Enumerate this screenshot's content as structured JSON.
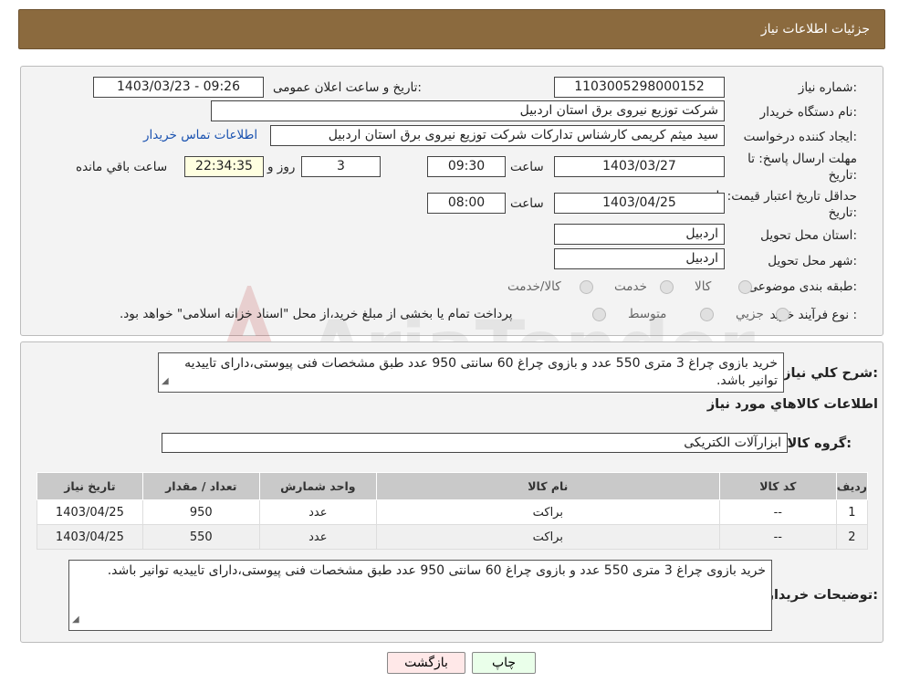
{
  "header": {
    "title": "جزئیات اطلاعات نیاز"
  },
  "form": {
    "need_number": {
      "label": "شماره نیاز:",
      "value": "1103005298000152"
    },
    "announce_datetime": {
      "label": "تاریخ و ساعت اعلان عمومی:",
      "value": "1403/03/23 - 09:26"
    },
    "buyer_org": {
      "label": "نام دستگاه خریدار:",
      "value": "شرکت توزیع نیروی برق استان اردبیل"
    },
    "requester": {
      "label": "ایجاد کننده درخواست:",
      "value": "سید میثم کریمی کارشناس تدارکات شرکت توزیع نیروی برق استان اردبیل",
      "contact_link": "اطلاعات تماس خریدار"
    },
    "reply_deadline": {
      "label_line1": "مهلت ارسال پاسخ: تا",
      "label_line2": "تاریخ:",
      "date": "1403/03/27",
      "time_label": "ساعت",
      "time": "09:30",
      "days": "3",
      "days_label": "روز و",
      "remaining": "22:34:35",
      "remaining_label": "ساعت باقي مانده"
    },
    "price_validity": {
      "label_line1": "حداقل تاریخ اعتبار قیمت: تا",
      "label_line2": "تاریخ:",
      "date": "1403/04/25",
      "time_label": "ساعت",
      "time": "08:00"
    },
    "province": {
      "label": "استان محل تحویل:",
      "value": "اردبیل"
    },
    "city": {
      "label": "شهر محل تحویل:",
      "value": "اردبیل"
    },
    "category": {
      "label": "طبقه بندی موضوعی:",
      "options": [
        "کالا",
        "خدمت",
        "کالا/خدمت"
      ]
    },
    "process_type": {
      "label": "نوع فرآیند خرید :",
      "options": [
        "جزیي",
        "متوسط"
      ],
      "note": "پرداخت تمام یا بخشی از مبلغ خرید،از محل \"اسناد خزانه اسلامی\" خواهد بود."
    }
  },
  "watermark": {
    "text": "AriaTender.neT"
  },
  "details": {
    "general_desc_label": "شرح کلي نیاز:",
    "general_desc": "خرید بازوی چراغ 3 متری 550 عدد و بازوی چراغ 60 سانتی 950 عدد طبق مشخصات فنی پیوستی،دارای تاییدیه توانیر باشد.",
    "goods_info_title": "اطلاعات کالاهاي مورد نياز",
    "goods_group_label": "گروه کالا:",
    "goods_group": "ابزارآلات الکتریکی",
    "table": {
      "headers": [
        "ردیف",
        "کد کالا",
        "نام کالا",
        "واحد شمارش",
        "تعداد / مقدار",
        "تاریخ نیاز"
      ],
      "rows": [
        [
          "1",
          "--",
          "براکت",
          "عدد",
          "950",
          "1403/04/25"
        ],
        [
          "2",
          "--",
          "براکت",
          "عدد",
          "550",
          "1403/04/25"
        ]
      ]
    },
    "buyer_notes_label": "توضیحات خریدار:",
    "buyer_notes": "خرید بازوی چراغ 3 متری 550 عدد و بازوی چراغ 60 سانتی 950 عدد طبق مشخصات فنی پیوستی،دارای تاییدیه توانیر باشد."
  },
  "buttons": {
    "print": "چاپ",
    "back": "بازگشت"
  }
}
